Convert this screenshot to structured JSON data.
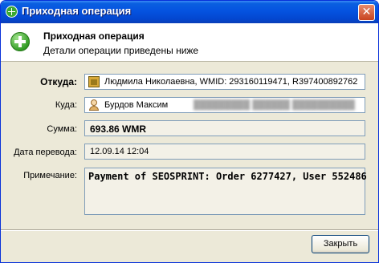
{
  "window": {
    "title": "Приходная операция"
  },
  "header": {
    "title": "Приходная операция",
    "subtitle": "Детали операции приведены ниже"
  },
  "fields": {
    "from_label": "Откуда:",
    "from_value": "Людмила Николаевна, WMID: 293160119471, R397400892762",
    "to_label": "Куда:",
    "to_value": "Бурдов Максим",
    "amount_label": "Сумма:",
    "amount_value": "693.86 WMR",
    "date_label": "Дата перевода:",
    "date_value": "12.09.14 12:04",
    "note_label": "Примечание:",
    "note_value": "Payment of SEOSPRINT: Order 6277427, User 552486"
  },
  "buttons": {
    "close_label": "Закрыть"
  }
}
